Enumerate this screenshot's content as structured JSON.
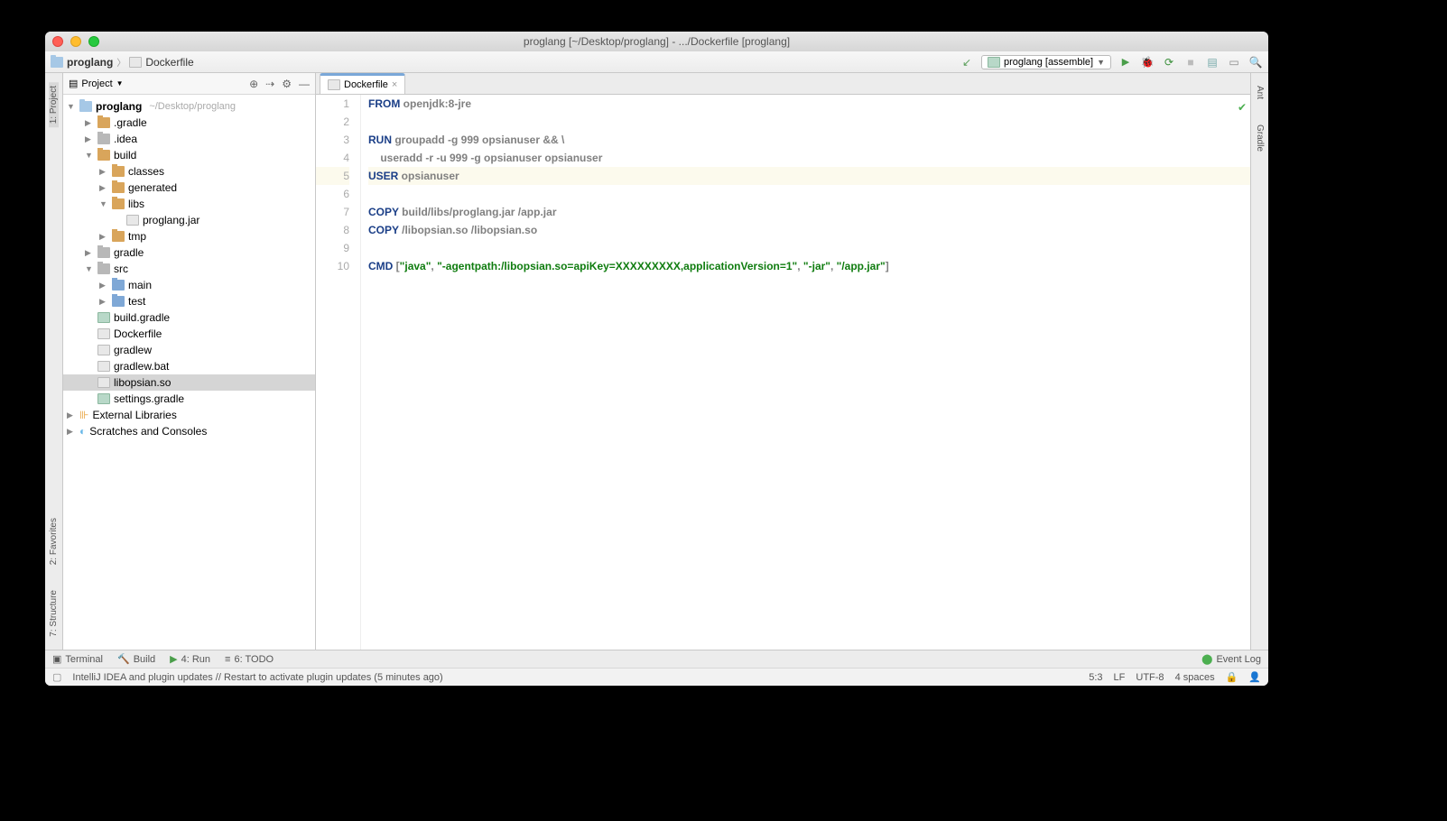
{
  "titlebar": "proglang [~/Desktop/proglang] - .../Dockerfile [proglang]",
  "breadcrumb": {
    "root": "proglang",
    "file": "Dockerfile"
  },
  "runConfig": "proglang [assemble]",
  "sidebar": {
    "title": "Project",
    "rootName": "proglang",
    "rootPath": "~/Desktop/proglang",
    "items": [
      {
        "label": ".gradle",
        "depth": 1,
        "type": "fold",
        "arrow": "▶"
      },
      {
        "label": ".idea",
        "depth": 1,
        "type": "fold-grey",
        "arrow": "▶"
      },
      {
        "label": "build",
        "depth": 1,
        "type": "fold",
        "arrow": "▼"
      },
      {
        "label": "classes",
        "depth": 2,
        "type": "fold",
        "arrow": "▶"
      },
      {
        "label": "generated",
        "depth": 2,
        "type": "fold",
        "arrow": "▶"
      },
      {
        "label": "libs",
        "depth": 2,
        "type": "fold",
        "arrow": "▼"
      },
      {
        "label": "proglang.jar",
        "depth": 3,
        "type": "file",
        "arrow": ""
      },
      {
        "label": "tmp",
        "depth": 2,
        "type": "fold",
        "arrow": "▶"
      },
      {
        "label": "gradle",
        "depth": 1,
        "type": "fold-grey",
        "arrow": "▶"
      },
      {
        "label": "src",
        "depth": 1,
        "type": "fold-grey",
        "arrow": "▼"
      },
      {
        "label": "main",
        "depth": 2,
        "type": "fold-blue",
        "arrow": "▶"
      },
      {
        "label": "test",
        "depth": 2,
        "type": "fold-blue",
        "arrow": "▶"
      },
      {
        "label": "build.gradle",
        "depth": 1,
        "type": "gradle",
        "arrow": ""
      },
      {
        "label": "Dockerfile",
        "depth": 1,
        "type": "file",
        "arrow": ""
      },
      {
        "label": "gradlew",
        "depth": 1,
        "type": "file",
        "arrow": ""
      },
      {
        "label": "gradlew.bat",
        "depth": 1,
        "type": "file",
        "arrow": ""
      },
      {
        "label": "libopsian.so",
        "depth": 1,
        "type": "file",
        "arrow": "",
        "selected": true
      },
      {
        "label": "settings.gradle",
        "depth": 1,
        "type": "gradle",
        "arrow": ""
      }
    ],
    "extLib": "External Libraries",
    "scratches": "Scratches and Consoles"
  },
  "tab": {
    "name": "Dockerfile"
  },
  "code": {
    "l1": {
      "kw": "FROM",
      "rest": " openjdk:8-jre"
    },
    "l3": {
      "kw": "RUN",
      "rest": " groupadd -g 999 opsianuser && \\"
    },
    "l4": "    useradd -r -u 999 -g opsianuser opsianuser",
    "l5": {
      "kw": "USER",
      "rest": " opsianuser"
    },
    "l7": {
      "kw": "COPY",
      "rest": " build/libs/proglang.jar /app.jar"
    },
    "l8": {
      "kw": "COPY",
      "rest": " /libopsian.so /libopsian.so"
    },
    "l10_kw": "CMD",
    "l10_s1": "\"java\"",
    "l10_s2": "\"-agentpath:/libopsian.so=apiKey=XXXXXXXXX,applicationVersion=1\"",
    "l10_s3": "\"-jar\"",
    "l10_s4": "\"/app.jar\""
  },
  "bottomBar": {
    "terminal": "Terminal",
    "build": "Build",
    "run": "4: Run",
    "todo": "6: TODO",
    "eventLog": "Event Log"
  },
  "status": {
    "msg": "IntelliJ IDEA and plugin updates // Restart to activate plugin updates (5 minutes ago)",
    "pos": "5:3",
    "sep": "LF",
    "enc": "UTF-8",
    "indent": "4 spaces"
  },
  "leftTabs": {
    "project": "1: Project",
    "structure": "7: Structure",
    "favorites": "2: Favorites"
  },
  "rightTabs": {
    "ant": "Ant",
    "gradle": "Gradle"
  }
}
